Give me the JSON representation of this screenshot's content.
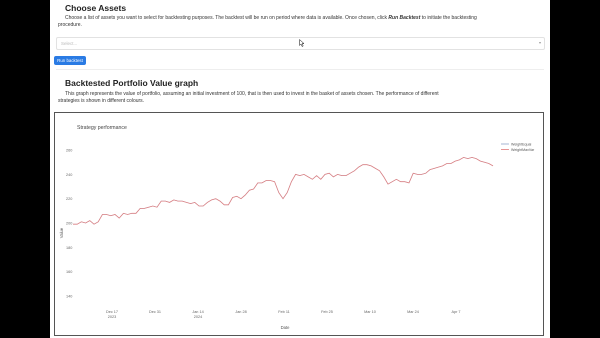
{
  "assets_section": {
    "title": "Choose Assets",
    "description_part1": "Choose a list of assets you want to select for backtesting purposes. The backtest will be run on period where data is available. Once chosen, click ",
    "description_emphasis": "Run Backtest",
    "description_part2": " to initiate the backtesting procedure.",
    "select_placeholder": "Select...",
    "run_button_label": "Run backtest"
  },
  "graph_section": {
    "title": "Backtested Portfolio Value graph",
    "description": "This graph represents the value of portfolio, assuming an initial investment of 100, that is then used to invest in the basket of assets chosen. The performance of different strategies is shown in different colours."
  },
  "chart_data": {
    "type": "line",
    "title": "Strategy performance",
    "xlabel": "Date",
    "ylabel": "Value",
    "x_tick_labels": [
      "Dec 17\n2023",
      "Dec 31",
      "Jan 14\n2024",
      "Jan 28",
      "Feb 11",
      "Feb 25",
      "Mar 10",
      "Mar 24",
      "Apr 7"
    ],
    "y_tick_labels": [
      "140",
      "160",
      "180",
      "200",
      "220",
      "240",
      "260"
    ],
    "ylim": [
      130,
      270
    ],
    "legend_position": "top-right",
    "colors": {
      "equal": "#8ea4c8",
      "max": "#e07a7a"
    },
    "series": [
      {
        "name": "WeightEqual",
        "values": [
          199,
          199,
          201,
          200,
          202,
          199,
          201,
          207,
          207,
          206,
          207,
          204,
          208,
          207,
          208,
          208,
          212,
          212,
          213,
          214,
          213,
          218,
          218,
          217,
          219,
          218,
          218,
          217,
          216,
          217,
          214,
          214,
          217,
          219,
          220,
          218,
          215,
          215,
          221,
          222,
          220,
          223,
          227,
          228,
          233,
          233,
          235,
          235,
          234,
          225,
          220,
          225,
          234,
          240,
          239,
          240,
          238,
          236,
          239,
          236,
          240,
          241,
          238,
          240,
          239,
          239,
          241,
          243,
          246,
          248,
          248,
          247,
          245,
          243,
          238,
          232,
          234,
          236,
          234,
          234,
          233,
          241,
          240,
          240,
          241,
          244,
          245,
          246,
          247,
          249,
          249,
          251,
          252,
          254,
          253,
          254,
          253,
          251,
          250,
          249,
          247
        ]
      },
      {
        "name": "WeightMaxVar",
        "values": [
          199,
          199,
          201,
          200,
          202,
          199,
          201,
          207,
          207,
          206,
          207,
          204,
          208,
          207,
          208,
          208,
          212,
          212,
          213,
          214,
          213,
          218,
          218,
          217,
          219,
          218,
          218,
          217,
          216,
          217,
          214,
          214,
          217,
          219,
          220,
          218,
          215,
          215,
          221,
          222,
          220,
          223,
          227,
          228,
          233,
          233,
          235,
          235,
          234,
          225,
          220,
          225,
          234,
          240,
          239,
          240,
          238,
          236,
          239,
          236,
          240,
          241,
          238,
          240,
          239,
          239,
          241,
          243,
          246,
          248,
          248,
          247,
          245,
          243,
          238,
          232,
          234,
          236,
          234,
          234,
          233,
          241,
          240,
          240,
          241,
          244,
          245,
          246,
          247,
          249,
          249,
          251,
          252,
          254,
          253,
          254,
          253,
          251,
          250,
          249,
          247
        ]
      }
    ]
  }
}
